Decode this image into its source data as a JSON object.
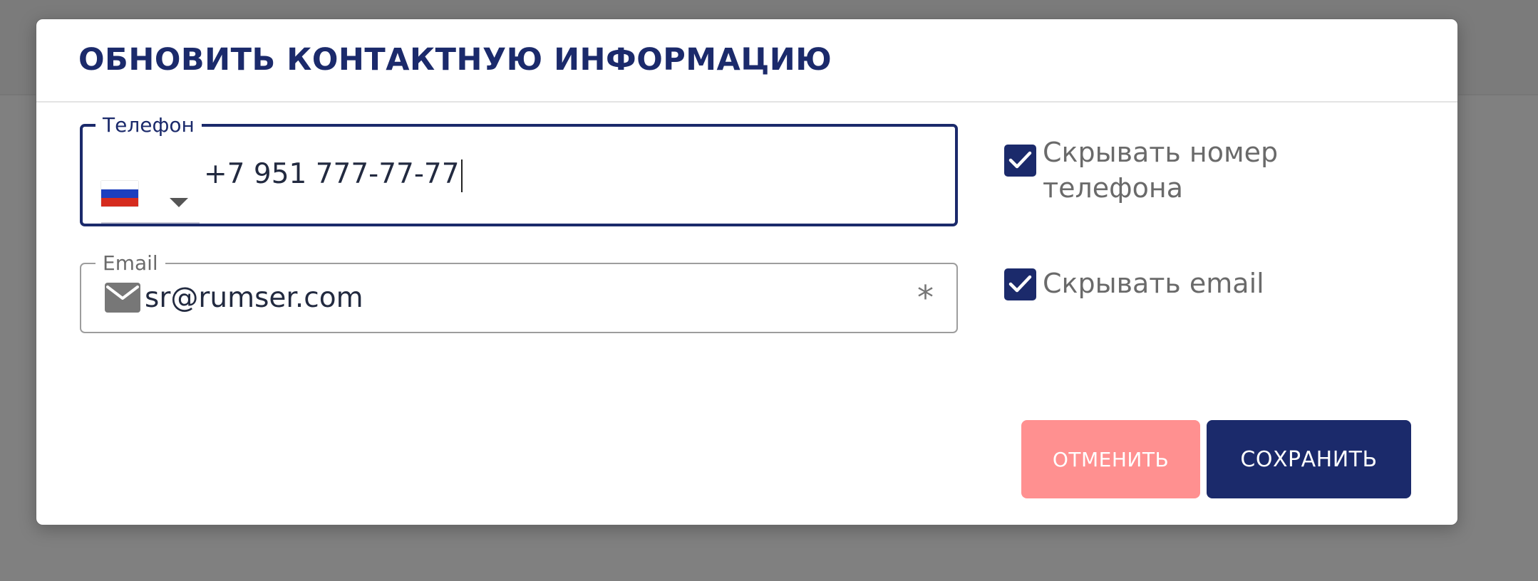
{
  "dialog": {
    "title": "ОБНОВИТЬ КОНТАКТНУЮ ИНФОРМАЦИЮ"
  },
  "phone": {
    "label": "Телефон",
    "value": "+7 951 777-77-77",
    "country_flag": "russia-flag",
    "country_colors": [
      "#ffffff",
      "#1c3fbf",
      "#d52b1e"
    ]
  },
  "email": {
    "label": "Email",
    "value": "sr@rumser.com",
    "required_mark": "*",
    "icon": "mail-icon"
  },
  "options": {
    "hide_phone": {
      "label": "Скрывать номер телефона",
      "checked": true
    },
    "hide_email": {
      "label": "Скрывать email",
      "checked": true
    }
  },
  "actions": {
    "cancel_label": "ОТМЕНИТЬ",
    "save_label": "СОХРАНИТЬ"
  },
  "colors": {
    "primary": "#1b2a6b",
    "cancel": "#ff9090",
    "backdrop": "#808080"
  }
}
